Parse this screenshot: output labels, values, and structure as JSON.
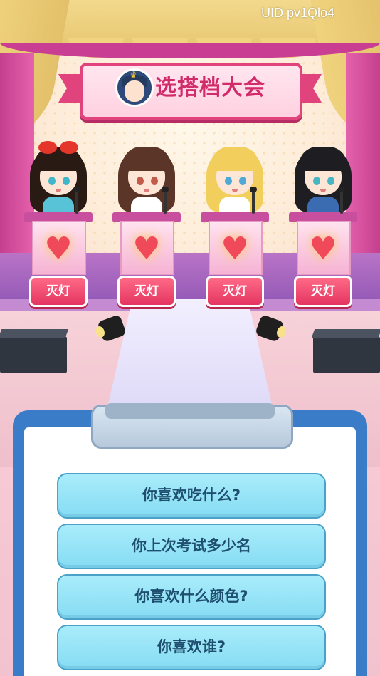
{
  "uid": "UID:pv1Qlo4",
  "title": "选搭档大会",
  "contestants": [
    {
      "name": "contestant-1",
      "button": "灭灯",
      "hair": "#2a1a14",
      "outfit": "#58c3d6",
      "eyes": "#3fb6c9"
    },
    {
      "name": "contestant-2",
      "button": "灭灯",
      "hair": "#5a3528",
      "outfit": "#ffffff",
      "eyes": "#c45a4a"
    },
    {
      "name": "contestant-3",
      "button": "灭灯",
      "hair": "#f2cf5c",
      "outfit": "#ffffff",
      "eyes": "#4fa9d6"
    },
    {
      "name": "contestant-4",
      "button": "灭灯",
      "hair": "#1d1d22",
      "outfit": "#3b6bb0",
      "eyes": "#45b6c2"
    }
  ],
  "questions": [
    "你喜欢吃什么?",
    "你上次考试多少名",
    "你喜欢什么颜色?",
    "你喜欢谁?"
  ],
  "colors": {
    "accent": "#e43561",
    "option_bg": "#86dcf3",
    "clipboard": "#3a7cc8"
  }
}
